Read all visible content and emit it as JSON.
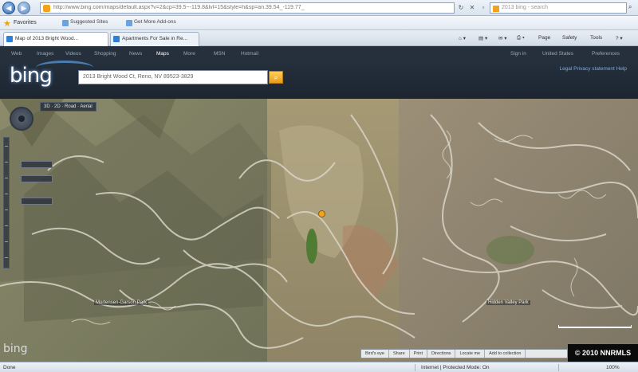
{
  "browser": {
    "address_url": "http://www.bing.com/maps/default.aspx?v=2&cp=39.5~-119.8&lvl=15&style=h&sp=an.39.54_-119.77_",
    "search_placeholder": "2013 bing - search",
    "favorites_label": "Favorites",
    "favorites": [
      "Suggested Sites",
      "Get More Add-ons"
    ],
    "tabs": [
      "Map of 2013 Bright Wood...",
      "Apartments For Sale in Re..."
    ],
    "commands": [
      "Page",
      "Safety",
      "Tools"
    ]
  },
  "bing": {
    "logo": "bing",
    "nav": [
      "Web",
      "Images",
      "Videos",
      "Shopping",
      "News",
      "Maps",
      "More",
      "MSN",
      "Hotmail"
    ],
    "nav_right": [
      "Sign in",
      "United States",
      "Preferences"
    ],
    "search_value": "2013 Bright Wood Ct, Reno, NV 89523-3829",
    "right_link": "Legal  Privacy statement  Help"
  },
  "map": {
    "toolbar": [
      "3D",
      "2D",
      "Road",
      "Aerial"
    ],
    "place_labels": [
      "Mortensen-Garson Park",
      "Hidden Valley Park"
    ],
    "bottom_bar": [
      "Bird's eye",
      "Share",
      "Print",
      "Directions",
      "Locate me",
      "Add to collection"
    ],
    "watermark": "bing",
    "copyright": "© 2010 NNRMLS",
    "pin_color": "#f4a21c"
  },
  "status": {
    "left": "Done",
    "zone": "Internet | Protected Mode: On",
    "zoom": "100%"
  }
}
